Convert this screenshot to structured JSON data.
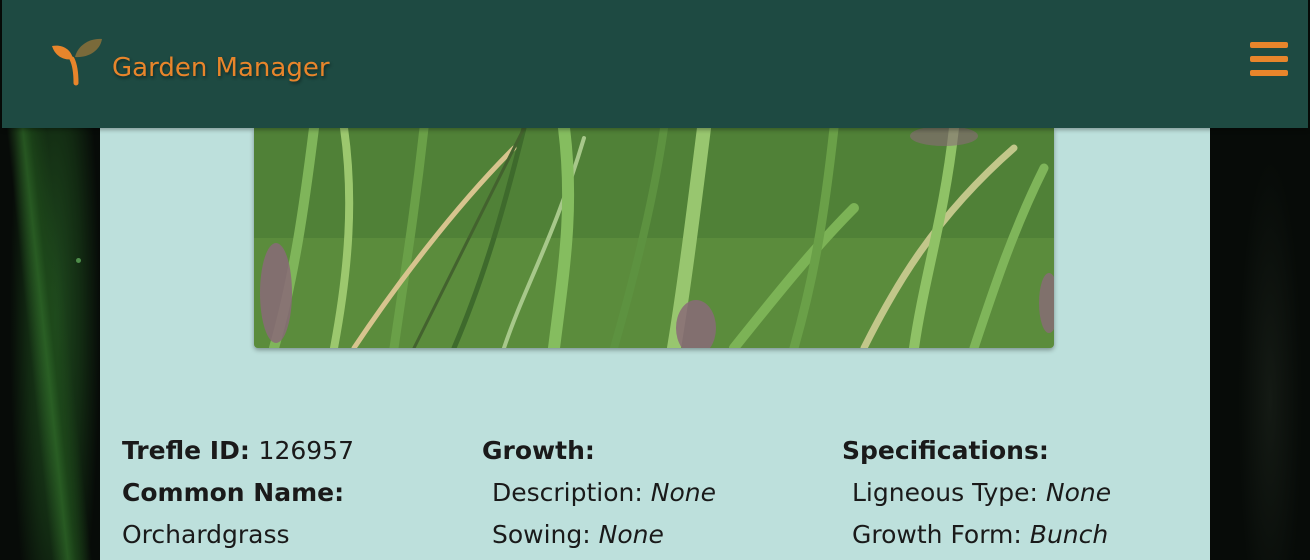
{
  "app": {
    "title": "Garden Manager",
    "accent": "#e8852b",
    "header_bg": "#1e4a42",
    "card_bg": "#bde0dc"
  },
  "icons": {
    "logo": "sprout-icon",
    "menu": "hamburger-menu-icon"
  },
  "plant": {
    "trefle_id_label": "Trefle ID:",
    "trefle_id": "126957",
    "common_name_label": "Common Name:",
    "common_name": "Orchardgrass",
    "growth": {
      "heading": "Growth:",
      "description_label": "Description:",
      "description": "None",
      "sowing_label": "Sowing:",
      "sowing": "None"
    },
    "specifications": {
      "heading": "Specifications:",
      "ligneous_type_label": "Ligneous Type:",
      "ligneous_type": "None",
      "growth_form_label": "Growth Form:",
      "growth_form": "Bunch"
    }
  }
}
